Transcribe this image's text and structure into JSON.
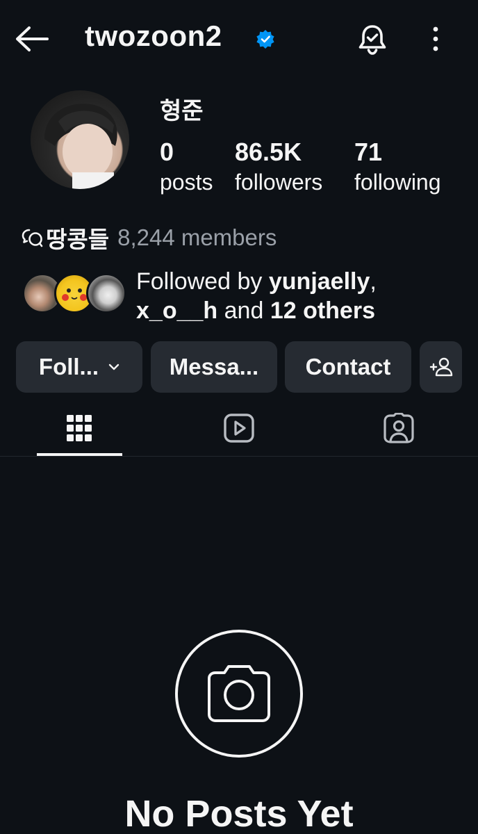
{
  "header": {
    "username": "twozoon2",
    "icons": {
      "back": "arrow-left-icon",
      "verified": "verified-badge-icon",
      "notifications": "bell-icon",
      "more": "more-vertical-icon"
    }
  },
  "profile": {
    "display_name": "형준",
    "stats": [
      {
        "value": "0",
        "label": "posts"
      },
      {
        "value": "86.5K",
        "label": "followers"
      },
      {
        "value": "71",
        "label": "following"
      }
    ]
  },
  "channel": {
    "name": "땅콩들",
    "members": "8,244 members"
  },
  "followed_by": {
    "prefix": "Followed by ",
    "user1": "yunjaelly",
    "comma": ",",
    "user2": "x_o__h",
    "mid": " and ",
    "others": "12 others"
  },
  "actions": {
    "follow_label": "Foll...",
    "message_label": "Messa...",
    "contact_label": "Contact"
  },
  "tabs": [
    {
      "name": "posts",
      "icon": "grid-icon",
      "active": true
    },
    {
      "name": "reels",
      "icon": "reels-icon",
      "active": false
    },
    {
      "name": "tagged",
      "icon": "tagged-icon",
      "active": false
    }
  ],
  "empty_state": {
    "icon": "camera-icon",
    "title": "No Posts Yet"
  },
  "colors": {
    "background": "#0d1116",
    "button": "#262b32",
    "verified": "#0095f6",
    "muted": "#9aa0a8"
  }
}
